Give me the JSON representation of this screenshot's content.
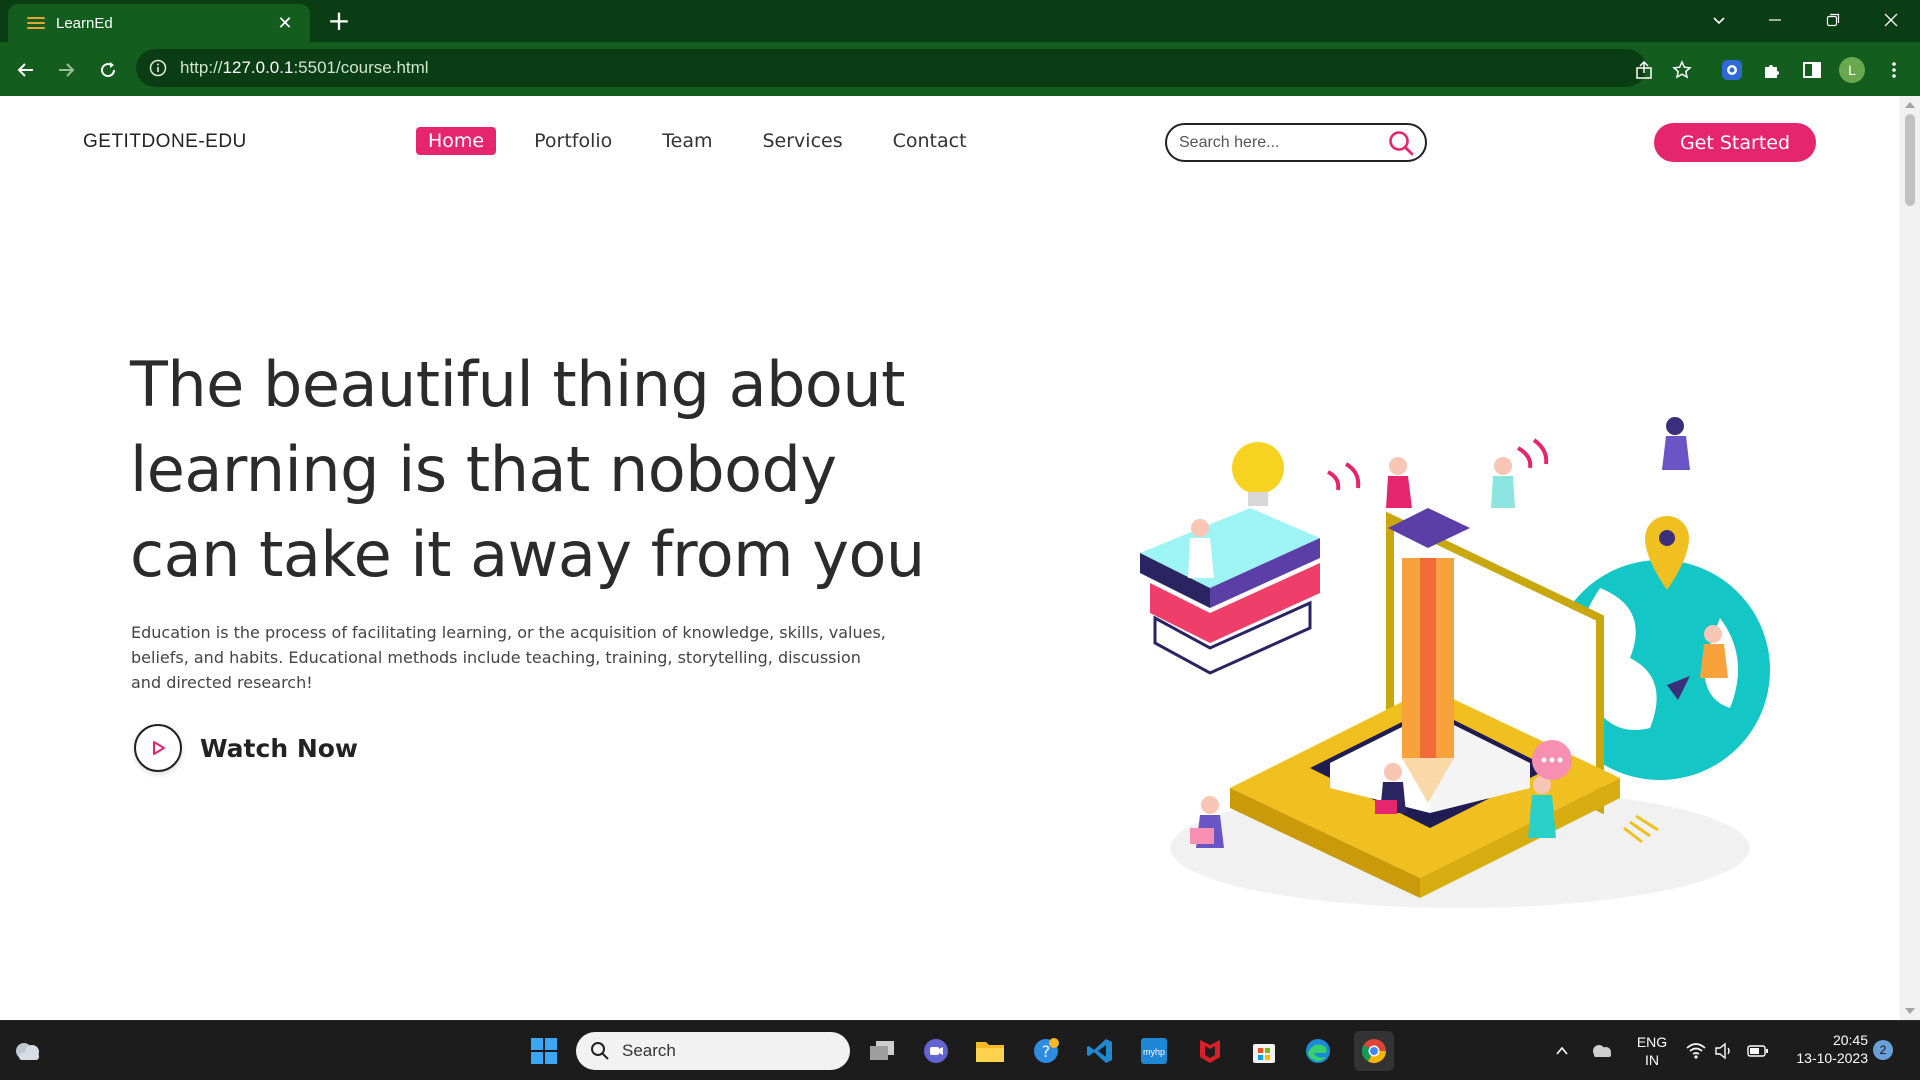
{
  "browser": {
    "tab_title": "LearnEd",
    "url_prefix": "http://",
    "url_host": "127.0.0.1",
    "url_rest": ":5501/course.html",
    "profile_initial": "L"
  },
  "site": {
    "brand": "GETITDONE-EDU",
    "nav": [
      "Home",
      "Portfolio",
      "Team",
      "Services",
      "Contact"
    ],
    "active_nav": "Home",
    "search_placeholder": "Search here...",
    "cta_label": "Get Started",
    "accent_color": "#e5266f"
  },
  "hero": {
    "headline": "The beautiful thing about learning is that nobody can take it away from you",
    "description": "Education is the process of facilitating learning, or the acquisition of knowledge, skills, values, beliefs, and habits. Educational methods include teaching, training, storytelling, discussion and directed research!",
    "watch_label": "Watch Now"
  },
  "taskbar": {
    "search_label": "Search",
    "language_line1": "ENG",
    "language_line2": "IN",
    "time": "20:45",
    "date": "13-10-2023",
    "notification_count": "2",
    "apps": [
      "start-icon",
      "file-explorer-icon",
      "teams-icon",
      "folder-icon",
      "help-icon",
      "vscode-icon",
      "myhp-icon",
      "mcafee-icon",
      "store-icon",
      "edge-icon",
      "chrome-icon"
    ]
  }
}
